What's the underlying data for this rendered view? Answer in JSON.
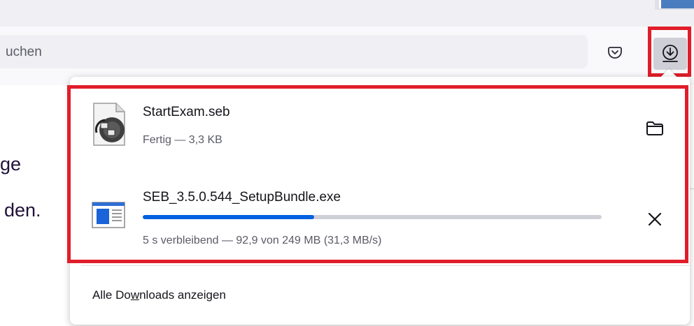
{
  "toolbar": {
    "url_placeholder_fragment": "uchen",
    "pocket_icon": "pocket-icon",
    "downloads_icon": "download-arrow-icon"
  },
  "page": {
    "line1": "ge",
    "line2": "den."
  },
  "downloads_panel": {
    "items": [
      {
        "file_name": "StartExam.seb",
        "status": "Fertig — 3,3 KB",
        "icon": "seb-file-icon",
        "action_icon": "folder-icon"
      },
      {
        "file_name": "SEB_3.5.0.544_SetupBundle.exe",
        "status": "5 s verbleibend — 92,9 von 249 MB (31,3 MB/s)",
        "progress_fraction": 0.373,
        "icon": "exe-file-icon",
        "action_icon": "cancel-icon"
      }
    ],
    "show_all_pre": "Alle Do",
    "show_all_accel": "w",
    "show_all_post": "nloads anzeigen"
  },
  "colors": {
    "highlight": "#e11d2a",
    "progress": "#0061e0",
    "button_active_bg": "#cfcfd8"
  }
}
